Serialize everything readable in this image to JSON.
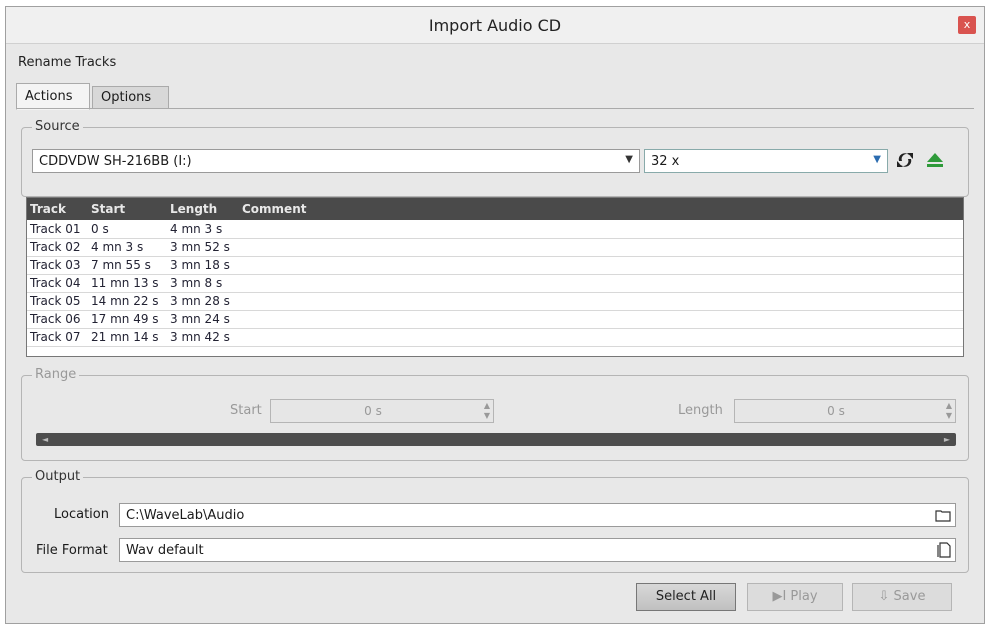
{
  "window": {
    "title": "Import Audio CD",
    "close_glyph": "x",
    "subtitle": "Rename Tracks"
  },
  "tabs": [
    {
      "label": "Actions",
      "active": true
    },
    {
      "label": "Options",
      "active": false
    }
  ],
  "source": {
    "legend": "Source",
    "drive": "CDDVDW SH-216BB (I:)",
    "speed": "32 x",
    "refresh_icon": "refresh-icon",
    "eject_icon": "eject-icon",
    "accent_eject": "#2e9a3a"
  },
  "tracklist": {
    "headers": [
      "Track",
      "Start",
      "Length",
      "Comment"
    ],
    "rows": [
      {
        "track": "Track 01",
        "start": "0 s",
        "length": "4 mn 3 s",
        "comment": ""
      },
      {
        "track": "Track 02",
        "start": "4 mn 3 s",
        "length": "3 mn 52 s",
        "comment": ""
      },
      {
        "track": "Track 03",
        "start": "7 mn 55 s",
        "length": "3 mn 18 s",
        "comment": ""
      },
      {
        "track": "Track 04",
        "start": "11 mn 13 s",
        "length": "3 mn 8 s",
        "comment": ""
      },
      {
        "track": "Track 05",
        "start": "14 mn 22 s",
        "length": "3 mn 28 s",
        "comment": ""
      },
      {
        "track": "Track 06",
        "start": "17 mn 49 s",
        "length": "3 mn 24 s",
        "comment": ""
      },
      {
        "track": "Track 07",
        "start": "21 mn 14 s",
        "length": "3 mn 42 s",
        "comment": ""
      }
    ]
  },
  "range": {
    "legend": "Range",
    "start_label": "Start",
    "start_value": "0 s",
    "length_label": "Length",
    "length_value": "0 s"
  },
  "output": {
    "legend": "Output",
    "location_label": "Location",
    "location_value": "C:\\WaveLab\\Audio",
    "format_label": "File Format",
    "format_value": "Wav default"
  },
  "buttons": {
    "select_all": "Select All",
    "play": "Play",
    "save": "Save"
  }
}
